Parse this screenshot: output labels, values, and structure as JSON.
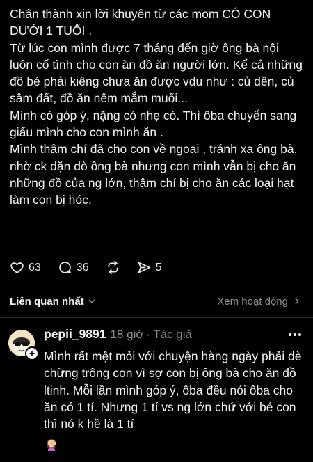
{
  "post": {
    "paragraphs": [
      "Chân thành xin lời khuyên từ các mom CÓ CON DƯỚI 1 TUỔI .",
      "Từ lúc con mình được 7 tháng đến giờ ông bà nội luôn cố tình cho con ăn đồ ăn người lớn. Kể cả những đồ bé phải kiêng chưa ăn được vdu như : củ dền, củ sâm đất, đồ ăn nêm mắm muối...",
      "Mình có góp ý, nặng có nhẹ có. Thì ôba chuyển sang giấu mình cho con mình ăn .",
      "Mình thậm chí đã cho con về ngoại , tránh xa ông bà, nhờ ck dặn dò ông bà nhưng con mình vẫn bị cho ăn những đồ của ng lớn, thậm chí bị cho ăn các loại hạt làm con bị hóc."
    ],
    "likes": "63",
    "comments": "36",
    "shares": "5"
  },
  "related": {
    "label": "Liên quan nhất",
    "activity": "Xem hoạt động"
  },
  "reply": {
    "username": "pepii_9891",
    "time": "18 giờ",
    "dot": "·",
    "author_tag": "Tác giả",
    "text": "Mình rất mệt mỏi với chuyện hàng ngày phải dè chừng trông con vì sợ con bị ông bà cho ăn đồ ltinh. Mỗi lần mình góp ý, ôba đều nói ôba cho ăn có 1 tí. Nhưng 1 tí vs ng lớn chứ với bé con thì nó k hề là 1 tí",
    "emoji": "woman-facepalming"
  },
  "icons": {
    "like": "heart-icon",
    "comment": "comment-bubble-icon",
    "repost": "repost-icon",
    "share": "send-icon",
    "chevron_down": "chevron-down-icon",
    "chevron_right": "chevron-right-icon",
    "more": "more-dots-icon"
  },
  "colors": {
    "background": "#000000",
    "text": "#f2f2f2",
    "muted": "#8e8e8e"
  }
}
